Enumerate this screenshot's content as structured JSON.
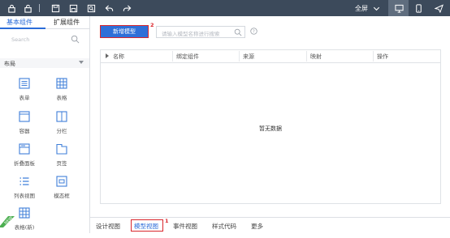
{
  "toolbar": {
    "fullscreen_label": "全屏",
    "icons": [
      "lock-icon",
      "unlock-icon",
      "separator",
      "save-icon",
      "save-as-icon",
      "preview-icon",
      "undo-icon",
      "redo-icon"
    ]
  },
  "sidebar": {
    "tabs": [
      "基本组件",
      "扩展组件"
    ],
    "search_placeholder": "Search",
    "section_title": "布局",
    "components": [
      {
        "label": "表单",
        "icon": "form-icon"
      },
      {
        "label": "表格",
        "icon": "table-icon"
      },
      {
        "label": "容器",
        "icon": "container-icon"
      },
      {
        "label": "分栏",
        "icon": "columns-icon"
      },
      {
        "label": "折叠面板",
        "icon": "collapse-panel-icon"
      },
      {
        "label": "页签",
        "icon": "tab-page-icon"
      },
      {
        "label": "列表视图",
        "icon": "list-view-icon"
      },
      {
        "label": "模态框",
        "icon": "modal-icon"
      },
      {
        "label": "表格(新)",
        "icon": "table-new-icon"
      }
    ],
    "new_badge": "NEW"
  },
  "main": {
    "add_button": "新增模型",
    "add_marker": "2",
    "search_placeholder": "请输入模型名称进行搜索",
    "columns": [
      "名称",
      "绑定组件",
      "来源",
      "映射",
      "操作"
    ],
    "empty_text": "暂无数据"
  },
  "bottom_tabs": {
    "items": [
      "设计视图",
      "模型视图",
      "事件视图",
      "样式代码",
      "更多"
    ],
    "active_marker": "1"
  },
  "colors": {
    "toolbar": "#3c4a5b",
    "accent": "#2b6cd8",
    "button": "#2f6fd8",
    "highlight": "#d9262c"
  }
}
